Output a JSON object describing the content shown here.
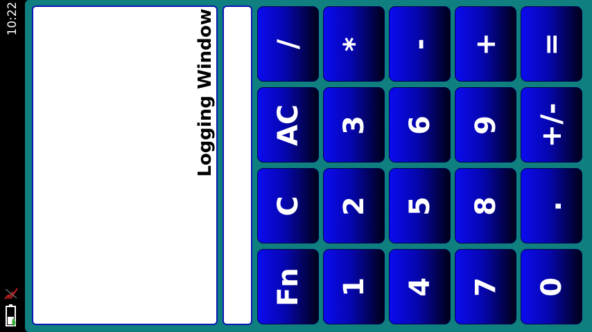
{
  "status_bar": {
    "time": "10:22",
    "icons": [
      "signal-icon",
      "battery-icon"
    ]
  },
  "logging_window": {
    "title": "Logging Window"
  },
  "display": {
    "value": ""
  },
  "colors": {
    "app_background": "#0f7f80",
    "button_gradient_start": "#0b0bf0",
    "button_gradient_end": "#000018",
    "panel_border": "#0b14b4",
    "button_text": "#ffffff"
  },
  "keypad": {
    "row1": [
      "/",
      "*",
      "-",
      "+",
      "="
    ],
    "row2": [
      "AC",
      "3",
      "6",
      "9",
      "+/-"
    ],
    "row3": [
      "C",
      "2",
      "5",
      "8",
      "."
    ],
    "row4": [
      "Fn",
      "1",
      "4",
      "7",
      "0"
    ]
  }
}
